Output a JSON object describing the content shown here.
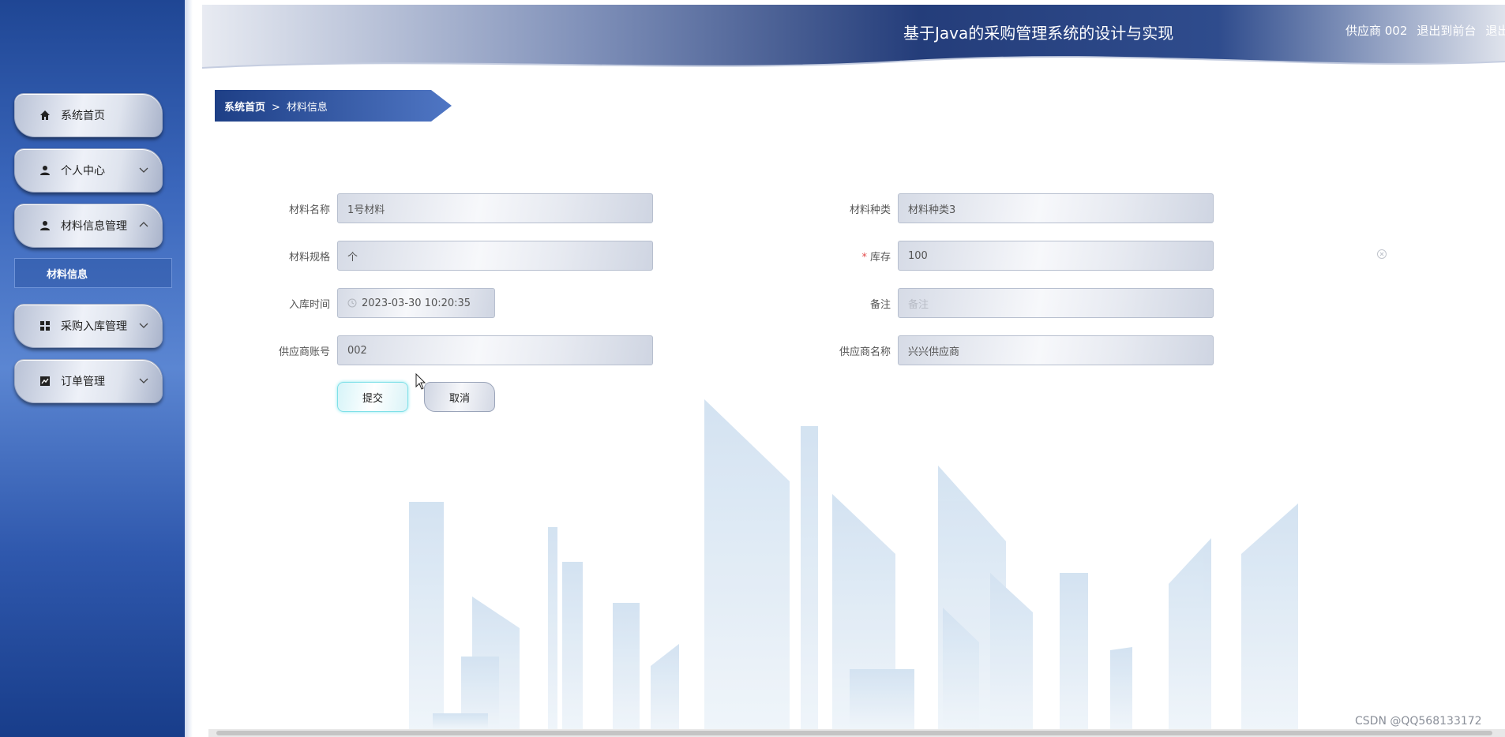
{
  "header": {
    "title": "基于Java的采购管理系统的设计与实现",
    "user_label": "供应商 002",
    "back_to_front": "退出到前台",
    "logout": "退出登录"
  },
  "sidebar": {
    "items": [
      {
        "label": "系统首页",
        "icon": "home-icon"
      },
      {
        "label": "个人中心",
        "icon": "user-icon"
      },
      {
        "label": "材料信息管理",
        "icon": "user-icon"
      },
      {
        "label": "采购入库管理",
        "icon": "grid-icon"
      },
      {
        "label": "订单管理",
        "icon": "chart-icon"
      }
    ],
    "sub_item": "材料信息"
  },
  "breadcrumb": {
    "home": "系统首页",
    "separator": ">",
    "current": "材料信息"
  },
  "form": {
    "material_name": {
      "label": "材料名称",
      "value": "1号材料"
    },
    "material_type": {
      "label": "材料种类",
      "value": "材料种类3"
    },
    "spec": {
      "label": "材料规格",
      "value": "个"
    },
    "stock": {
      "label": "库存",
      "value": "100",
      "required_mark": "*"
    },
    "storage_time": {
      "label": "入库时间",
      "value": "2023-03-30 10:20:35"
    },
    "remark": {
      "label": "备注",
      "placeholder": "备注"
    },
    "supplier_account": {
      "label": "供应商账号",
      "value": "002"
    },
    "supplier_name": {
      "label": "供应商名称",
      "value": "兴兴供应商"
    }
  },
  "buttons": {
    "submit": "提交",
    "cancel": "取消"
  },
  "watermark": "CSDN @QQ568133172",
  "colors": {
    "sidebar_dark": "#1f4694",
    "header_dark": "#243d7a",
    "accent_cyan": "#7fe0e8"
  }
}
